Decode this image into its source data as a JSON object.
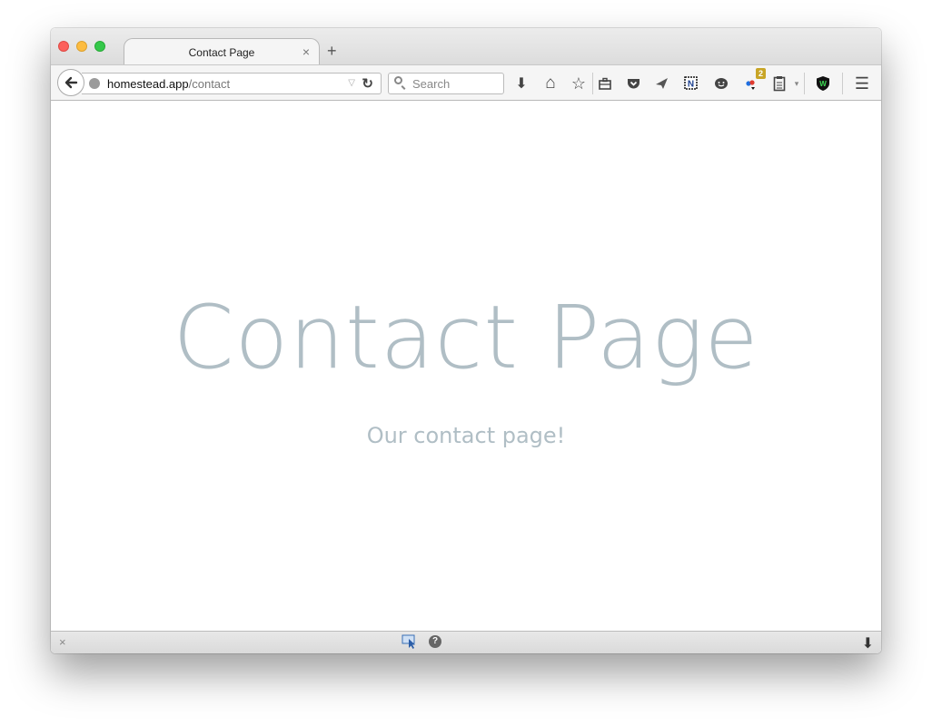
{
  "tab": {
    "title": "Contact Page",
    "close_glyph": "×",
    "new_tab_glyph": "+"
  },
  "urlbar": {
    "host": "homestead.app",
    "path": "/contact",
    "dropdown_glyph": "▽",
    "reload_glyph": "↻"
  },
  "search": {
    "placeholder": "Search"
  },
  "toolbar": {
    "download_glyph": "⬇",
    "home_glyph": "⌂",
    "bookmark_glyph": "☆",
    "menu_glyph": "☰",
    "addon_badge": "2"
  },
  "page": {
    "title": "Contact Page",
    "subtitle": "Our contact page!"
  },
  "statusbar": {
    "close_glyph": "×",
    "help_glyph": "?",
    "download_glyph": "⬇"
  },
  "colors": {
    "page_text": "#b0bec5",
    "close_traffic": "#fc605b",
    "minimize_traffic": "#fdbc40",
    "maximize_traffic": "#34c84a",
    "badge": "#c8a526"
  }
}
